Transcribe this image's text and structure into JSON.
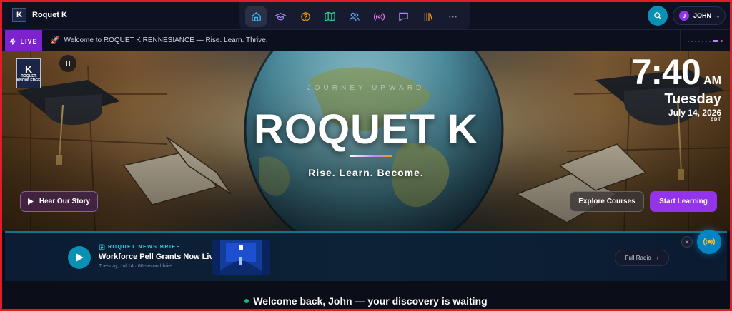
{
  "brand": {
    "logo_letter": "K",
    "name": "Roquet K"
  },
  "nav": {
    "items": [
      {
        "name": "home-icon",
        "active": true
      },
      {
        "name": "graduation-cap-icon"
      },
      {
        "name": "help-circle-icon"
      },
      {
        "name": "map-icon"
      },
      {
        "name": "users-icon"
      },
      {
        "name": "broadcast-icon"
      },
      {
        "name": "chat-icon"
      },
      {
        "name": "library-icon"
      },
      {
        "name": "more-icon"
      }
    ]
  },
  "user": {
    "initial": "J",
    "name": "JOHN"
  },
  "ticker": {
    "live_label": "LIVE",
    "message": "Welcome to ROQUET K RENNESIANCE — Rise. Learn. Thrive."
  },
  "hero": {
    "logo_letter": "K",
    "logo_text_1": "ROQUET",
    "logo_text_2": "KNOWLEDGE",
    "eyebrow": "JOURNEY UPWARD",
    "title": "ROQUET K",
    "tagline": "Rise. Learn. Become.",
    "buttons": {
      "story": "Hear Our Story",
      "explore": "Explore Courses",
      "start": "Start Learning"
    }
  },
  "clock": {
    "time": "7:40",
    "ampm": "AM",
    "day": "Tuesday",
    "date": "July 14, 2026",
    "tz": "EDT"
  },
  "news": {
    "eyebrow": "ROQUET NEWS BRIEF",
    "title": "Workforce Pell Grants Now Live",
    "subtitle": "Tuesday, Jul 14 · 60-second brief",
    "full_radio": "Full Radio"
  },
  "welcome": {
    "message": "Welcome back, John — your discovery is waiting"
  },
  "colors": {
    "accent": "#9333ea",
    "cyan": "#0891b2",
    "live": "#7e22ce"
  }
}
